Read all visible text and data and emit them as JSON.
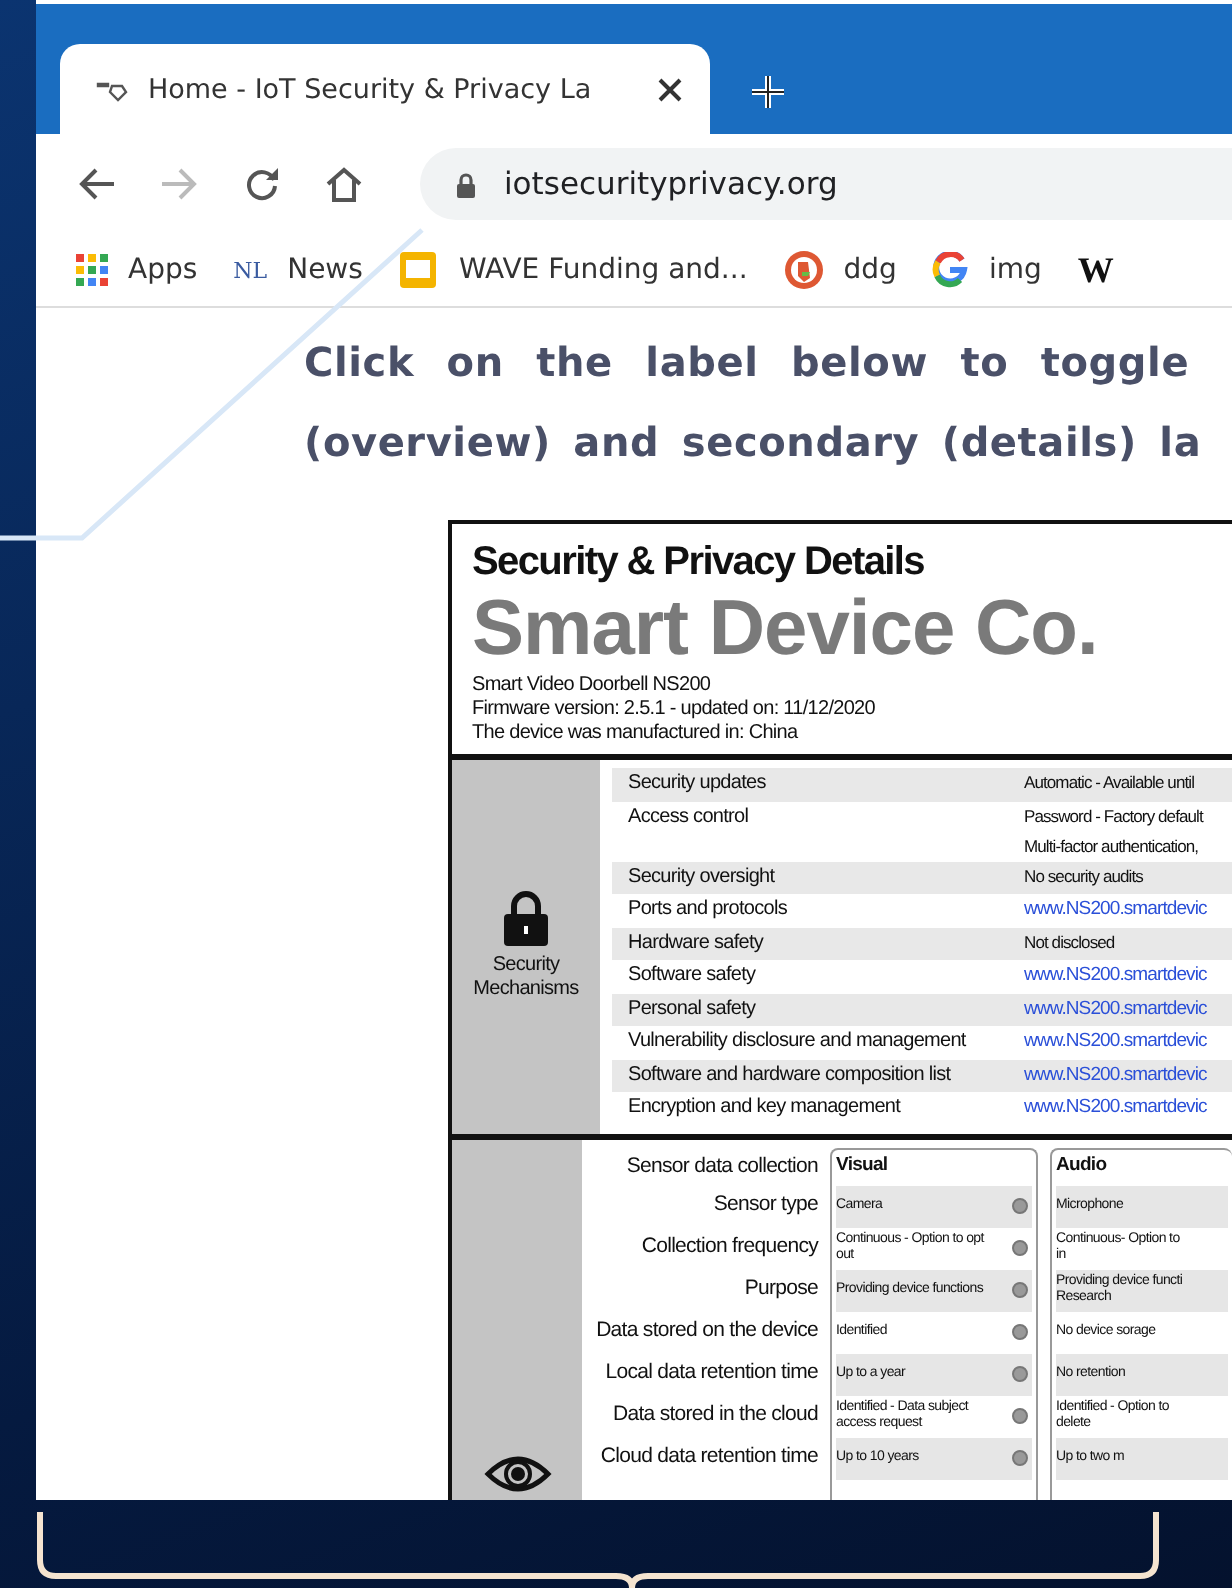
{
  "tab": {
    "title": "Home - IoT Security & Privacy La",
    "selected": true
  },
  "address_bar": {
    "url": "iotsecurityprivacy.org"
  },
  "bookmarks": [
    {
      "kind": "apps",
      "label": "Apps"
    },
    {
      "kind": "text-icon",
      "icon_text": "NL",
      "label": "News"
    },
    {
      "kind": "folder",
      "label": "WAVE Funding and..."
    },
    {
      "kind": "duck",
      "label": "ddg"
    },
    {
      "kind": "google",
      "label": "img"
    },
    {
      "kind": "text-icon-serif",
      "icon_text": "W"
    }
  ],
  "intro": [
    "Click on the label below to toggle",
    "(overview) and secondary (details) la"
  ],
  "label": {
    "title": "Security & Privacy Details",
    "brand": "Smart Device Co.",
    "device_lines": [
      "Smart Video Doorbell NS200",
      "Firmware version: 2.5.1 - updated on: 11/12/2020",
      "The device was manufactured in: China"
    ],
    "security": {
      "category": "Security Mechanisms",
      "rows": [
        {
          "name": "Security updates",
          "kind": "text",
          "value": "Automatic - Available until"
        },
        {
          "name": "Access control",
          "kind": "text",
          "value": "Password - Factory default\nMulti-factor authentication,"
        },
        {
          "name": "Security oversight",
          "kind": "text",
          "value": "No security audits"
        },
        {
          "name": "Ports and protocols",
          "kind": "link",
          "value": "www.NS200.smartdevic"
        },
        {
          "name": "Hardware safety",
          "kind": "text",
          "value": "Not disclosed"
        },
        {
          "name": "Software safety",
          "kind": "link",
          "value": "www.NS200.smartdevic"
        },
        {
          "name": "Personal safety",
          "kind": "link",
          "value": "www.NS200.smartdevic"
        },
        {
          "name": "Vulnerability disclosure and management",
          "kind": "link",
          "value": "www.NS200.smartdevic"
        },
        {
          "name": "Software and hardware composition list",
          "kind": "link",
          "value": "www.NS200.smartdevic"
        },
        {
          "name": "Encryption and key management",
          "kind": "link",
          "value": "www.NS200.smartdevic"
        }
      ]
    },
    "privacy": {
      "header": "Sensor data collection",
      "columns": [
        "Visual",
        "Audio"
      ],
      "rows": [
        {
          "name": "Sensor type",
          "values": [
            "Camera",
            "Microphone"
          ]
        },
        {
          "name": "Collection frequency",
          "values": [
            "Continuous - Option to opt\nout",
            "Continuous- Option to\nin"
          ]
        },
        {
          "name": "Purpose",
          "values": [
            "Providing device functions",
            "Providing device functi\nResearch"
          ]
        },
        {
          "name": "Data stored on the device",
          "values": [
            "Identified",
            "No device sorage"
          ]
        },
        {
          "name": "Local data retention time",
          "values": [
            "Up to a year",
            "No retention"
          ]
        },
        {
          "name": "Data stored in the cloud",
          "values": [
            "Identified - Data subject\naccess request",
            "Identified - Option to\ndelete"
          ]
        },
        {
          "name": "Cloud data retention time",
          "values": [
            "Up to 10 years",
            "Up to two m"
          ]
        }
      ]
    }
  }
}
